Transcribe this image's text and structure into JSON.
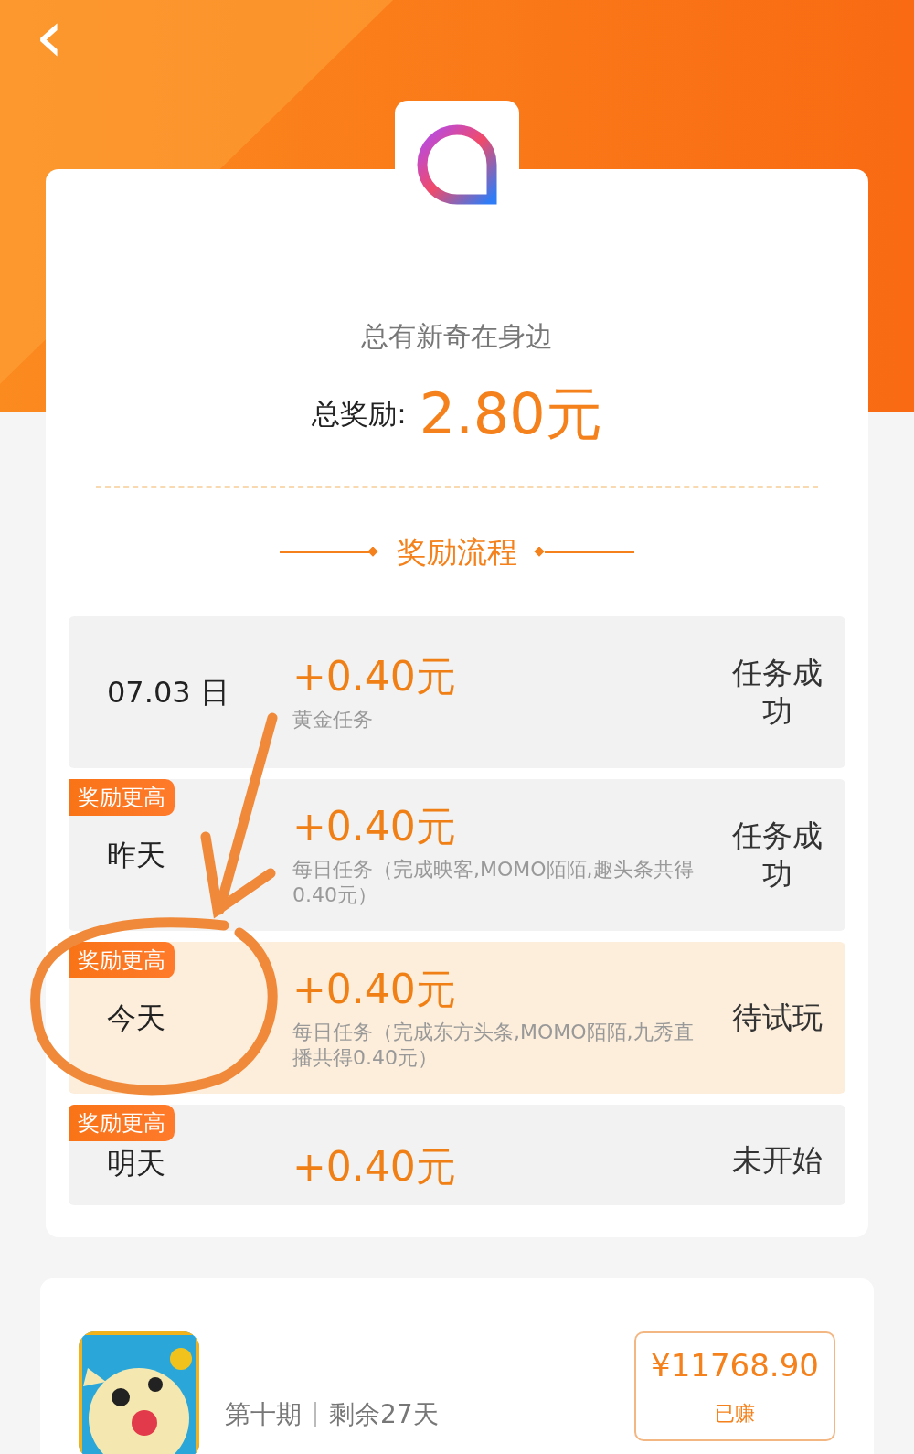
{
  "header": {
    "back": "‹"
  },
  "summary": {
    "slogan": "总有新奇在身边",
    "total_label": "总奖励:",
    "total_value": "2.80元"
  },
  "section_title": "奖励流程",
  "rows": [
    {
      "date": "07.03 日",
      "badge": "",
      "amount": "+0.40元",
      "desc": "黄金任务",
      "status": "任务成功",
      "selected": false
    },
    {
      "date": "昨天",
      "badge": "奖励更高",
      "amount": "+0.40元",
      "desc": "每日任务（完成映客,MOMO陌陌,趣头条共得0.40元）",
      "status": "任务成功",
      "selected": false
    },
    {
      "date": "今天",
      "badge": "奖励更高",
      "amount": "+0.40元",
      "desc": "每日任务（完成东方头条,MOMO陌陌,九秀直播共得0.40元）",
      "status": "待试玩",
      "selected": true
    },
    {
      "date": "明天",
      "badge": "奖励更高",
      "amount": "+0.40元",
      "desc": "",
      "status": "未开始",
      "selected": false
    }
  ],
  "game": {
    "period": "第十期",
    "remaining": "剩余27天",
    "price": "¥11768.90",
    "earned_label": "已赚"
  }
}
